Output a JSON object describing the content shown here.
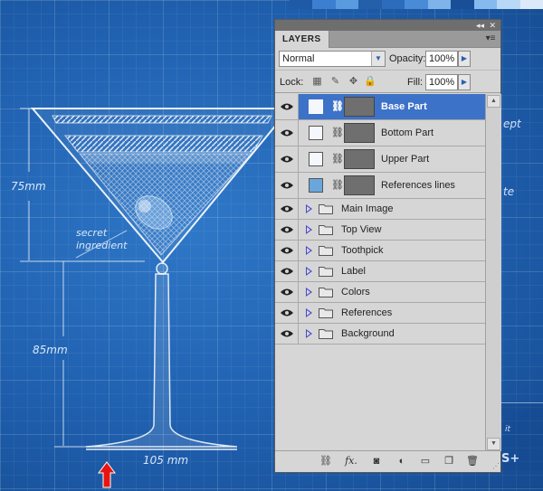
{
  "blueprint": {
    "dim_75": "75mm",
    "dim_85": "85mm",
    "dim_105": "105 mm",
    "secret_line1": "secret",
    "secret_line2": "ingredient",
    "edge_text_1": "ept",
    "edge_text_2": "te",
    "edge_text_3": "it",
    "edge_text_4": "S+",
    "strip_colors": [
      "#1f5aa6",
      "#3c7fd0",
      "#5a9be0",
      "#245faa",
      "#2d6cbd",
      "#4a8bd8",
      "#7fb4ea",
      "#1a4f98",
      "#86b9ee",
      "#b9d8f5",
      "#dce9f8"
    ]
  },
  "panel": {
    "collapse_glyph": "◂◂",
    "close_glyph": "✕",
    "tab_label": "LAYERS",
    "menu_icon": "▾≡",
    "blend_mode": "Normal",
    "opacity_label": "Opacity:",
    "opacity_value": "100%",
    "lock_label": "Lock:",
    "fill_label": "Fill:",
    "fill_value": "100%",
    "layers": [
      {
        "name": "Base Part",
        "selected": true
      },
      {
        "name": "Bottom Part",
        "selected": false
      },
      {
        "name": "Upper Part",
        "selected": false
      },
      {
        "name": "References lines",
        "selected": false
      }
    ],
    "groups": [
      {
        "name": "Main Image"
      },
      {
        "name": "Top View"
      },
      {
        "name": "Toothpick"
      },
      {
        "name": "Label"
      },
      {
        "name": "Colors"
      },
      {
        "name": "References"
      },
      {
        "name": "Background"
      }
    ],
    "footer_icons": [
      "link-layers-icon",
      "fx-icon",
      "add-mask-icon",
      "adjustment-layer-icon",
      "new-group-icon",
      "new-layer-icon",
      "delete-layer-icon"
    ]
  },
  "colors": {
    "selection": "#3d72c9",
    "panel_bg": "#d6d6d6",
    "blueprint_bg": "#1f5fae",
    "arrow_red": "#e8140f"
  }
}
